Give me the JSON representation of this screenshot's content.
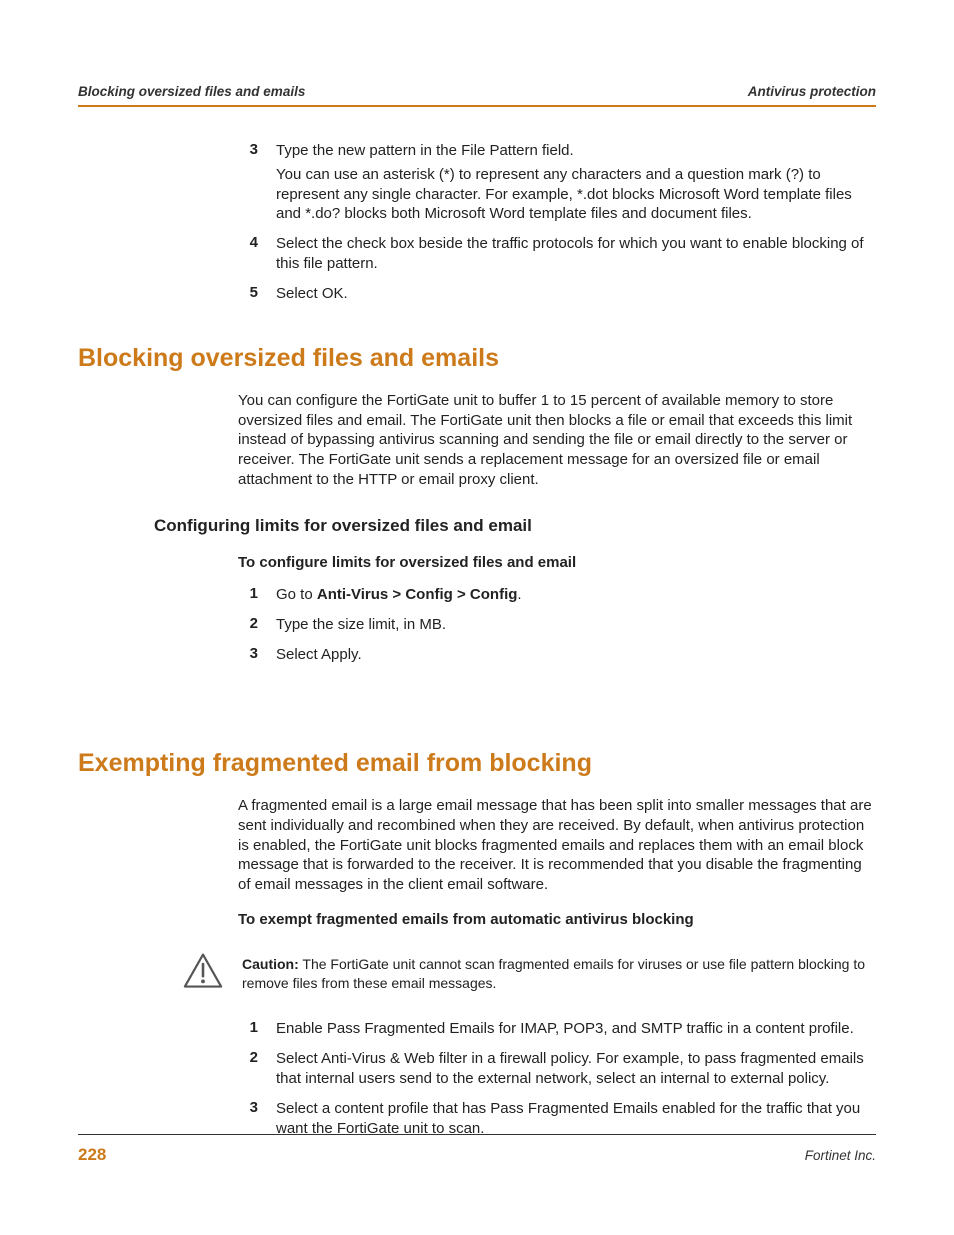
{
  "header": {
    "left": "Blocking oversized files and emails",
    "right": "Antivirus protection"
  },
  "topSteps": [
    {
      "num": "3",
      "paras": [
        "Type the new pattern in the File Pattern field.",
        "You can use an asterisk (*) to represent any characters and a question mark (?) to represent any single character. For example, *.dot blocks Microsoft Word template files and *.do? blocks both Microsoft Word template files and document files."
      ]
    },
    {
      "num": "4",
      "paras": [
        "Select the check box beside the traffic protocols for which you want to enable blocking of this file pattern."
      ]
    },
    {
      "num": "5",
      "paras": [
        "Select OK."
      ]
    }
  ],
  "sec1": {
    "title": "Blocking oversized files and emails",
    "intro": "You can configure the FortiGate unit to buffer 1 to 15 percent of available memory to store oversized files and email. The FortiGate unit then blocks a file or email that exceeds this limit instead of bypassing antivirus scanning and sending the file or email directly to the server or receiver. The FortiGate unit sends a replacement message for an oversized file or email attachment to the HTTP or email proxy client.",
    "sub": {
      "title": "Configuring limits for oversized files and email",
      "proc": "To configure limits for oversized files and email",
      "steps": [
        {
          "num": "1",
          "prefix": "Go to ",
          "bold": "Anti-Virus > Config > Config",
          "suffix": "."
        },
        {
          "num": "2",
          "text": "Type the size limit, in MB."
        },
        {
          "num": "3",
          "text": "Select Apply."
        }
      ]
    }
  },
  "sec2": {
    "title": "Exempting fragmented email from blocking",
    "intro": "A fragmented email is a large email message that has been split into smaller messages that are sent individually and recombined when they are received. By default, when antivirus protection is enabled, the FortiGate unit blocks fragmented emails and replaces them with an email block message that is forwarded to the receiver. It is recommended that you disable the fragmenting of email messages in the client email software.",
    "proc": "To exempt fragmented emails from automatic antivirus blocking",
    "caution": {
      "label": "Caution:",
      "text": " The FortiGate unit cannot scan fragmented emails for viruses or use file pattern blocking to remove files from these email messages."
    },
    "steps": [
      {
        "num": "1",
        "text": "Enable Pass Fragmented Emails for IMAP, POP3, and SMTP traffic in a content profile."
      },
      {
        "num": "2",
        "text": "Select Anti-Virus & Web filter in a firewall policy. For example, to pass fragmented emails that internal users send to the external network, select an internal to external policy."
      },
      {
        "num": "3",
        "text": "Select a content profile that has Pass Fragmented Emails enabled for the traffic that you want the FortiGate unit to scan."
      }
    ]
  },
  "footer": {
    "page": "228",
    "company": "Fortinet Inc."
  }
}
